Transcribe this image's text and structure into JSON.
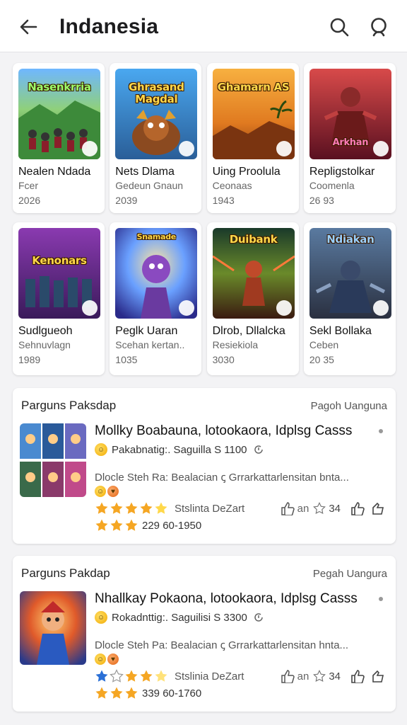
{
  "header": {
    "title": "Indanesia",
    "back_icon": "arrow-left-icon",
    "search_icon": "search-icon",
    "profile_icon": "profile-icon"
  },
  "grid_row1": [
    {
      "thumb_text": "Nasenkrria",
      "name": "Nealen Ndada",
      "sub": "Fcer",
      "num": "2026"
    },
    {
      "thumb_text": "Ghrasand Magdal",
      "name": "Nets Dlama",
      "sub": "Gedeun Gnaun",
      "num": "2039"
    },
    {
      "thumb_text": "Ghamarn AS",
      "name": "Uing Proolula",
      "sub": "Ceonaas",
      "num": "1943"
    },
    {
      "thumb_text": "Arkhan",
      "name": "Repligstolkar",
      "sub": "Coomenla",
      "num": "26 93"
    }
  ],
  "grid_row2": [
    {
      "thumb_text": "Kenonars",
      "name": "Sudlgueoh",
      "sub": "Sehnuvlagn",
      "num": "1989"
    },
    {
      "thumb_text": "Snamade",
      "name": "Peglk Uaran",
      "sub": "Scehan kertan..",
      "num": "1035"
    },
    {
      "thumb_text": "Duibank",
      "name": "Dlrob, Dllalcka",
      "sub": "Resiekiola",
      "num": "3030"
    },
    {
      "thumb_text": "Ndiakan",
      "name": "Sekl Bollaka",
      "sub": "Ceben",
      "num": "20 35"
    }
  ],
  "panels": [
    {
      "title": "Parguns Paksdap",
      "link": "Pagoh Uangunа",
      "name": "Mollky Boabauna, lotookaora, Idplsg Casss",
      "line2": "Pakabnatig:. Saguillа S 1100",
      "line3": "Dlocle Steh Ra:  Bealacian ꞔ Grrarkattarlensitan bnta...",
      "rating_label": "Stslinta DeZart",
      "likes": "34",
      "votes": "229 60-1950",
      "stars_main": 5,
      "stars_main_colored": [
        true,
        true,
        true,
        true,
        true
      ],
      "stars_small": 3
    },
    {
      "title": "Parguns Pakdap",
      "link": "Pegah Uangura",
      "name": "Nhallkay Pokaona, lotookaora, Idplsg Casss",
      "line2": "Rokadnttig:. Saguilisi S 3300",
      "line3": "Dlocle Steh Pa:  Bealacian ꞔ Grrarkattarlensitan hnta...",
      "rating_label": "Stslinia DeZart",
      "likes": "34",
      "votes": "339 60-1760",
      "stars_main": 5,
      "stars_main_colored": [
        true,
        false,
        true,
        true,
        false
      ],
      "stars_small": 3
    }
  ],
  "colors": {
    "accent_star": "#f5a623",
    "star_blue": "#2a6fd6",
    "text_primary": "#111111",
    "text_secondary": "#666666"
  }
}
